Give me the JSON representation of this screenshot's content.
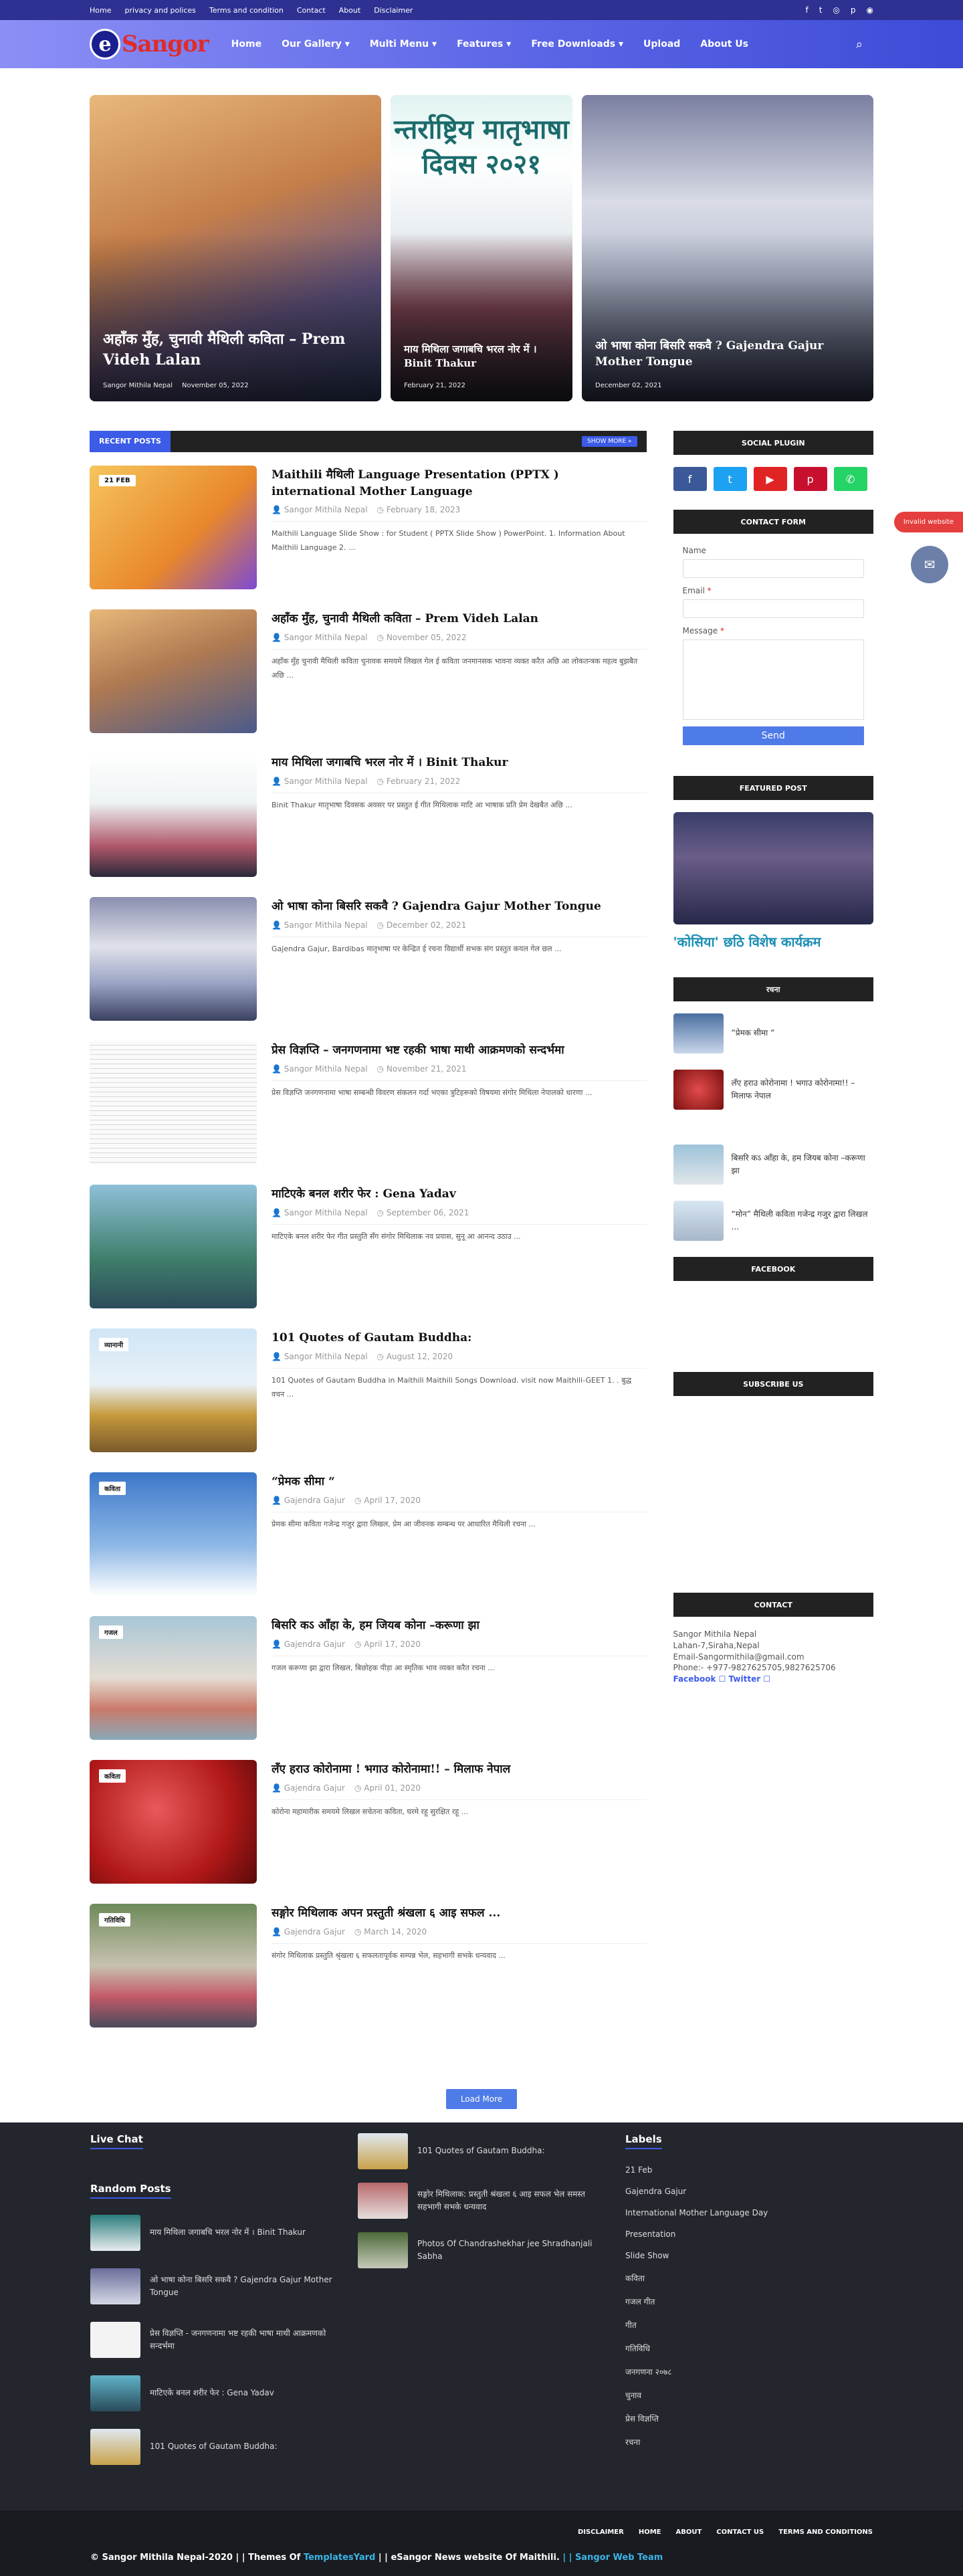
{
  "topbar": {
    "links": [
      "Home",
      "privacy and polices",
      "Terms and condition",
      "Contact",
      "About",
      "Disclaimer"
    ]
  },
  "nav": {
    "logo_e": "e",
    "logo_name": "Sangor",
    "items": [
      "Home",
      "Our Gallery",
      "Multi Menu",
      "Features",
      "Free Downloads",
      "Upload",
      "About Us"
    ]
  },
  "hero": [
    {
      "title": "अहाँक मुँह, चुनावी मैथिली कविता – Prem Videh Lalan",
      "author": "Sangor Mithila Nepal",
      "date": "November 05, 2022"
    },
    {
      "title": "माय मिथिला जगाबचि भरल नोर में । Binit Thakur",
      "author": "",
      "date": "February 21, 2022",
      "big": "न्तर्राष्ट्रिय मातृभाषा दिवस २०२१"
    },
    {
      "title": "ओ भाषा कोना बिसरि सकवै ? Gajendra Gajur Mother Tongue",
      "author": "",
      "date": "December 02, 2021"
    }
  ],
  "recent": {
    "label": "RECENT POSTS",
    "more": "SHOW MORE »"
  },
  "posts": [
    {
      "title": "Maithili मैथिली Language Presentation (PPTX ) international Mother Language",
      "author": "Sangor Mithila Nepal",
      "date": "February 18, 2023",
      "excerpt": "Maithili Language Slide Show : for Student ( PPTX Slide Show ) PowerPoint. 1. Information About Maithili Language  2. ...",
      "tag": "21 FEB"
    },
    {
      "title": "अहाँक मुँह, चुनावी मैथिली कविता – Prem Videh Lalan",
      "author": "Sangor Mithila Nepal",
      "date": "November 05, 2022",
      "excerpt": "अहाँक मुँह चुनावी मैथिली कविता चुनावक समयमे लिखल गेल ई कविता जनमानसक भावना व्यक्त करैत अछि आ लोकतन्त्रक महत्व बुझबैत अछि ...",
      "tag": ""
    },
    {
      "title": "माय मिथिला जगाबचि भरल नोर में । Binit Thakur",
      "author": "Sangor Mithila Nepal",
      "date": "February 21, 2022",
      "excerpt": "Binit Thakur मातृभाषा दिवसक अवसर पर प्रस्तुत ई गीत मिथिलाक माटि आ भाषाक प्रति प्रेम देखबैत अछि ...",
      "tag": ""
    },
    {
      "title": "ओ भाषा कोना बिसरि सकवै ? Gajendra Gajur Mother Tongue",
      "author": "Sangor Mithila Nepal",
      "date": "December 02, 2021",
      "excerpt": "Gajendra Gajur, Bardibas मातृभाषा पर केन्द्रित ई रचना विद्यार्थी सभक संग प्रस्तुत कयल गेल छल ...",
      "tag": ""
    },
    {
      "title": "प्रेस विज्ञप्ति – जनगणनामा भष्ट रहकी भाषा माथी आक्रमणको सन्दर्भमा",
      "author": "Sangor Mithila Nepal",
      "date": "November 21, 2021",
      "excerpt": "प्रेस विज्ञप्ति जनगणनामा भाषा सम्बन्धी विवरण संकलन गर्दा भएका त्रुटिहरूको विषयमा संगोर मिथिला नेपालको धारणा ...",
      "tag": ""
    },
    {
      "title": "माटिएके बनल शरीर फेर : Gena Yadav",
      "author": "Sangor Mithila Nepal",
      "date": "September 06, 2021",
      "excerpt": "माटिएके बनल शरीर फेर गीत प्रस्तुति सँग संगोर मिथिलाक नव प्रयास, सुनू आ आनन्द उठाउ ...",
      "tag": ""
    },
    {
      "title": "101 Quotes of Gautam Buddha:",
      "author": "Sangor Mithila Nepal",
      "date": "August 12, 2020",
      "excerpt": "101 Quotes of Gautam Buddha in Maithili  Maithili Songs Download. visit now Maithili-GEET 1. . बुद्ध वचन ...",
      "tag": "व्यानानी"
    },
    {
      "title": "“प्रेमक सीमा “",
      "author": "Gajendra Gajur",
      "date": "April 17, 2020",
      "excerpt": "प्रेमक सीमा कविता गजेन्द्र गजुर द्वारा लिखल, प्रेम आ जीवनक सम्बन्ध पर आधारित मैथिली रचना ...",
      "tag": "कविता"
    },
    {
      "title": "बिसरि कऽ आँहा के, हम जियब कोना –करूणा झा",
      "author": "Gajendra Gajur",
      "date": "April 17, 2020",
      "excerpt": "गजल करूणा झा द्वारा लिखल, बिछोहक पीड़ा आ स्मृतिक भाव व्यक्त करैत रचना ...",
      "tag": "गजल"
    },
    {
      "title": "लँए हराउ कोरोनामा ! भगाउ कोरोनामा!! – मिलाफ नेपाल",
      "author": "Gajendra Gajur",
      "date": "April 01, 2020",
      "excerpt": "कोरोना महामारीक समयमे लिखल सचेतना कविता, घरमे रहू सुरक्षित रहू ...",
      "tag": "कविता"
    },
    {
      "title": "सङ्गोर मिथिलाक अपन प्रस्तुती श्रंखला ६ आइ सफल ...",
      "author": "Gajendra Gajur",
      "date": "March 14, 2020",
      "excerpt": "संगोर मिथिलाक प्रस्तुति श्रृंखला ६ सफलतापूर्वक सम्पन्न भेल, सहभागी सभके धन्यवाद ...",
      "tag": "गतिविधि"
    }
  ],
  "loadmore": "Load More",
  "sidebar": {
    "social": "SOCIAL PLUGIN",
    "contactform": "CONTACT FORM",
    "name_label": "Name",
    "email_label": "Email",
    "message_label": "Message",
    "send": "Send",
    "required": "*",
    "featured": "FEATURED POST",
    "featured_title": "'कोसिया' छठि विशेष कार्यक्रम",
    "rachana": "रचना",
    "rachana_items": [
      "“प्रेमक सीमा “",
      "लँए हराउ कोरोनामा ! भगाउ कोरोनामा!! – मिलाफ नेपाल",
      "बिसरि कऽ आँहा के, हम जियब कोना –करूणा झा",
      "“मोन” मैथिली कविता गजेन्द्र गजुर द्वारा लिखल ..."
    ],
    "facebook": "FACEBOOK",
    "subscribe": "SUBSCRIBE US",
    "contact": "CONTACT",
    "contact_lines": [
      "Sangor Mithila Nepal",
      "Lahan-7,Siraha,Nepal",
      "Email-Sangormithila@gmail.com",
      "Phone:- +977-9827625705,9827625706"
    ],
    "contact_links": "Facebook ☐  Twitter ☐"
  },
  "floating": {
    "invalid": "Invalid website"
  },
  "footer": {
    "livechat": "Live Chat",
    "random": "Random Posts",
    "labels": "Labels",
    "random_items": [
      "माय मिथिला जगाबचि भरल नोर में । Binit Thakur",
      "ओ भाषा कोना बिसरि सकवै ? Gajendra Gajur Mother Tongue",
      "प्रेस विज्ञप्ति - जनगणनामा भष्ट रहकी भाषा माथी आक्रमणको सन्दर्भमा",
      "माटिएके बनल शरीर फेर : Gena Yadav",
      "101 Quotes of Gautam Buddha:"
    ],
    "mid_items": [
      "101 Quotes of Gautam Buddha:",
      "सङ्गोर मिथिलाक: प्रस्तुती श्रंखला ६ आइ सफल भेल समस्त सहभागी सभके धन्यवाद",
      "Photos Of Chandrashekhar jee Shradhanjali Sabha"
    ],
    "label_items": [
      "21 Feb",
      "Gajendra Gajur",
      "International Mother Language Day",
      "Presentation",
      "Slide Show",
      "कविता",
      "गजल गीत",
      "गीत",
      "गतिविधि",
      "जनगणना २०७८",
      "चुनाव",
      "प्रेस विज्ञप्ति",
      "रचना"
    ],
    "links": [
      "DISCLAIMER",
      "HOME",
      "ABOUT",
      "CONTACT US",
      "TERMS AND CONDITIONS"
    ],
    "copy1": "© Sangor Mithila Nepal-2020 | |  Themes Of ",
    "copy2": "TemplatesYard",
    "copy3": " | | eSangor News website Of Maithili. ",
    "copy4": "| | Sangor Web Team"
  },
  "colors": {
    "accent": "#3c5be6",
    "dark": "#222222",
    "footer": "#23262d"
  }
}
